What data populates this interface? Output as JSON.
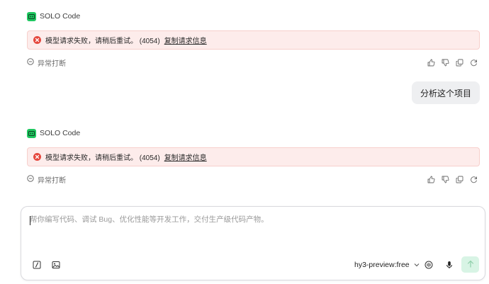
{
  "messages": [
    {
      "agent_name": "SOLO Code",
      "error_text": "模型请求失败，请稍后重试。 (4054)",
      "error_link": "复制请求信息",
      "status": "异常打断"
    },
    {
      "agent_name": "SOLO Code",
      "error_text": "模型请求失败，请稍后重试。 (4054)",
      "error_link": "复制请求信息",
      "status": "异常打断"
    }
  ],
  "user_message": "分析这个项目",
  "composer": {
    "placeholder": "帮你编写代码、调试 Bug、优化性能等开发工作，交付生产级代码产物。",
    "model": "hy3-preview:free"
  },
  "colors": {
    "brand": "#1fc760",
    "error_bg": "#fdeceb",
    "error_icon": "#e5483e",
    "send_bg": "#d8f4e5"
  }
}
